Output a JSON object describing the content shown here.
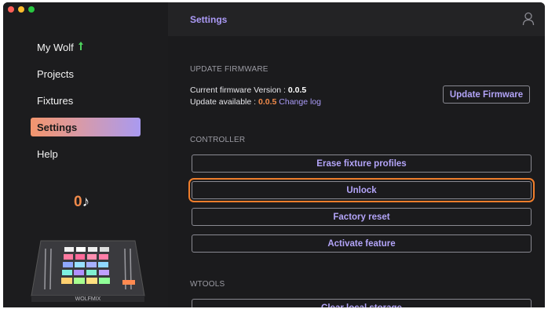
{
  "sidebar": {
    "items": [
      {
        "label": "My Wolf"
      },
      {
        "label": "Projects"
      },
      {
        "label": "Fixtures"
      },
      {
        "label": "Settings"
      },
      {
        "label": "Help"
      }
    ],
    "counter": {
      "value": "0",
      "symbol": "♪"
    },
    "device_brand": "WOLFMIX"
  },
  "header": {
    "title": "Settings"
  },
  "firmware": {
    "section_title": "UPDATE FIRMWARE",
    "current_label": "Current firmware Version : ",
    "current_version": "0.0.5",
    "available_label": "Update available : ",
    "available_version": "0.0.5",
    "changelog_label": "Change log",
    "update_button": "Update Firmware"
  },
  "controller": {
    "section_title": "CONTROLLER",
    "buttons": [
      {
        "label": "Erase fixture profiles"
      },
      {
        "label": "Unlock"
      },
      {
        "label": "Factory reset"
      },
      {
        "label": "Activate feature"
      }
    ]
  },
  "wtools": {
    "section_title": "WTOOLS",
    "buttons": [
      {
        "label": "Clear local storage"
      }
    ]
  },
  "colors": {
    "accent": "#ab9af6",
    "orange": "#f08a4b",
    "highlight_outline": "#f07e2c",
    "active_gradient_start": "#f2956d",
    "active_gradient_end": "#a99af0"
  }
}
